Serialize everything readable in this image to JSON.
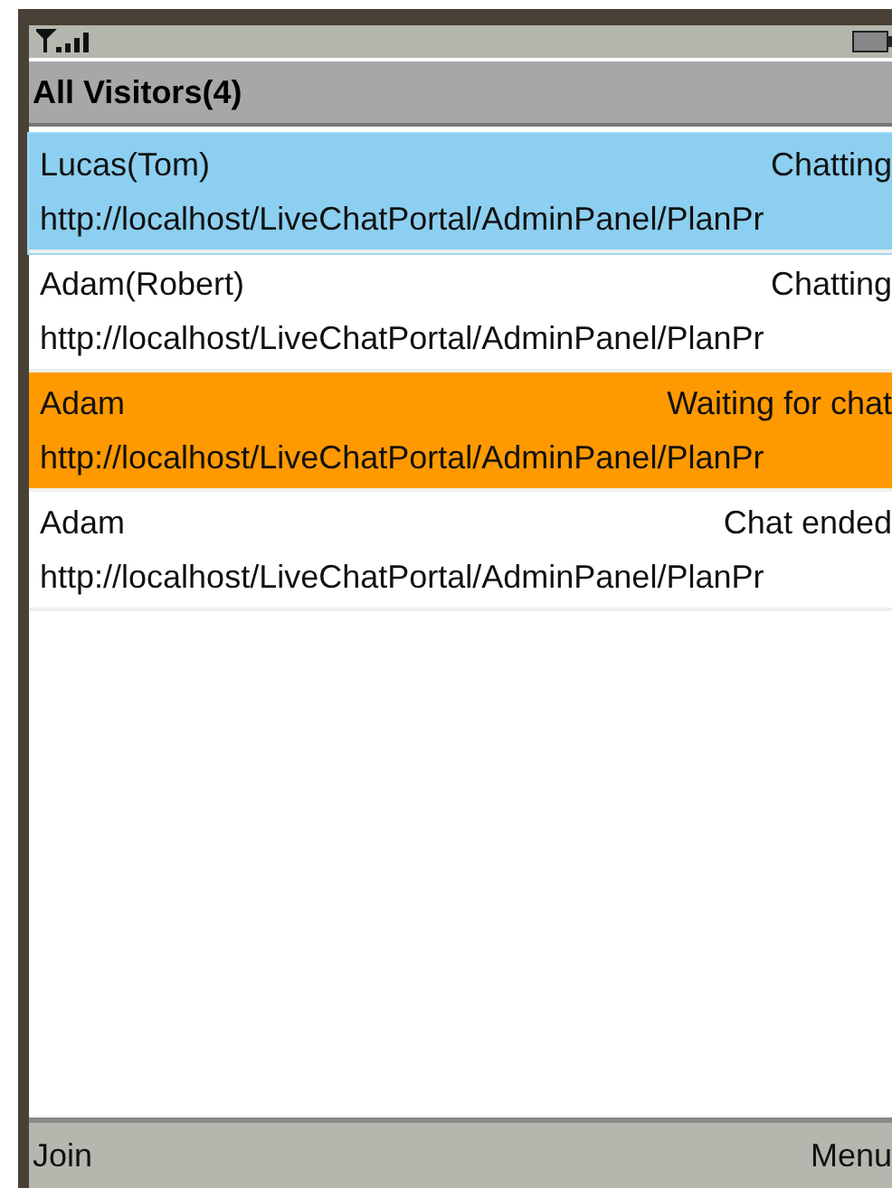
{
  "title": "All Visitors(4)",
  "visitors": [
    {
      "name": "Lucas(Tom)",
      "status": "Chatting",
      "url": "http://localhost/LiveChatPortal/AdminPanel/PlanPr",
      "selected": true,
      "color": "#8ccff0"
    },
    {
      "name": "Adam(Robert)",
      "status": "Chatting",
      "url": "http://localhost/LiveChatPortal/AdminPanel/PlanPr",
      "selected": false,
      "color": "#ffffff"
    },
    {
      "name": "Adam",
      "status": "Waiting for chat",
      "url": "http://localhost/LiveChatPortal/AdminPanel/PlanPr",
      "selected": false,
      "color": "#ff9900"
    },
    {
      "name": "Adam",
      "status": "Chat ended",
      "url": "http://localhost/LiveChatPortal/AdminPanel/PlanPr",
      "selected": false,
      "color": "#ffffff"
    }
  ],
  "softkeys": [
    "Join",
    "Menu"
  ]
}
